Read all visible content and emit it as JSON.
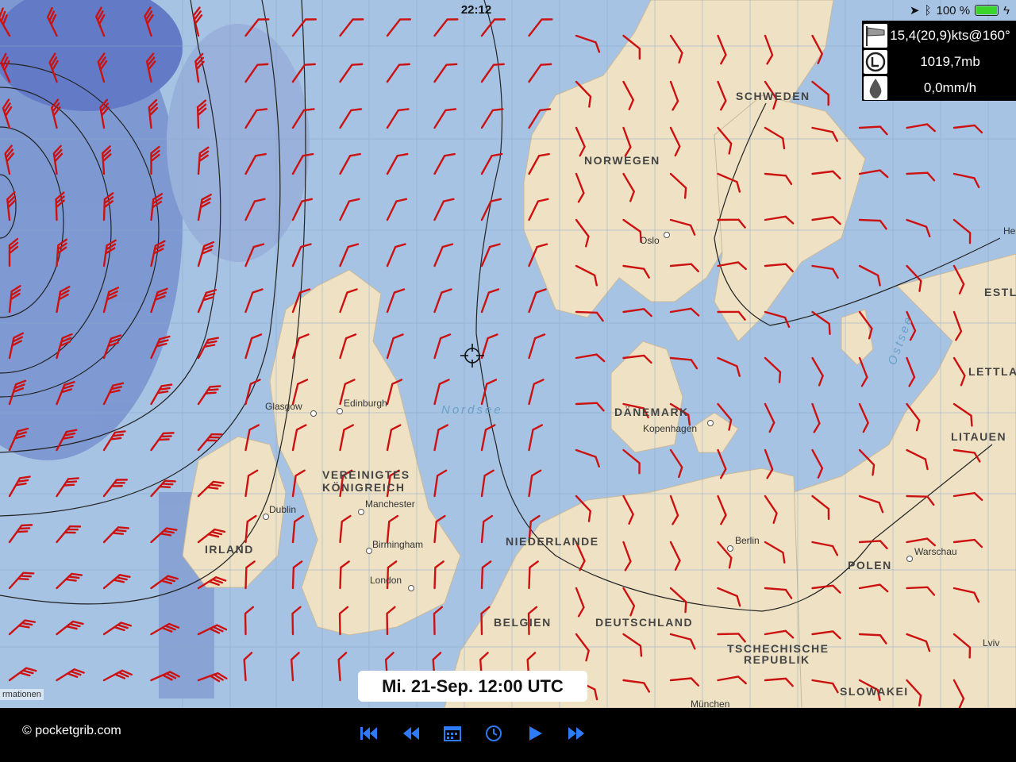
{
  "status_bar": {
    "time": "22:12",
    "battery_text": "100 %",
    "battery_level_percent": 100
  },
  "info_panel": {
    "wind": "15,4(20,9)kts@160°",
    "pressure": "1019,7mb",
    "precipitation": "0,0mm/h"
  },
  "map": {
    "countries": {
      "norway": "NORWEGEN",
      "sweden": "SCHWEDEN",
      "denmark": "DÄNEMARK",
      "uk_line1": "VEREINIGTES",
      "uk_line2": "KÖNIGREICH",
      "ireland": "IRLAND",
      "netherlands": "NIEDERLANDE",
      "belgium": "BELGIEN",
      "germany": "DEUTSCHLAND",
      "poland": "POLEN",
      "czech_line1": "TSCHECHISCHE",
      "czech_line2": "REPUBLIK",
      "slovakia": "SLOWAKEI",
      "estonia": "ESTL",
      "latvia": "LETTLA",
      "lithuania": "LITAUEN"
    },
    "cities": {
      "oslo": "Oslo",
      "glasgow": "Glasgow",
      "edinburgh": "Edinburgh",
      "copenhagen": "Kopenhagen",
      "dublin": "Dublin",
      "manchester": "Manchester",
      "birmingham": "Birmingham",
      "london": "London",
      "berlin": "Berlin",
      "warsaw": "Warschau",
      "munich": "München",
      "lviv": "Lviv",
      "helsinki": "He"
    },
    "seas": {
      "north_sea": "Nordsee",
      "baltic": "Ostsee"
    },
    "attribution": "rmationen",
    "colors": {
      "sea": "#a6c3e3",
      "land": "#efe2c4",
      "wind_barb": "#cc1111"
    }
  },
  "forecast_time": "Mi. 21-Sep. 12:00 UTC",
  "toolbar": {
    "copyright": "© pocketgrib.com",
    "buttons": [
      "skip-to-start-icon",
      "step-back-icon",
      "calendar-icon",
      "clock-icon",
      "play-icon",
      "fast-forward-icon"
    ]
  }
}
